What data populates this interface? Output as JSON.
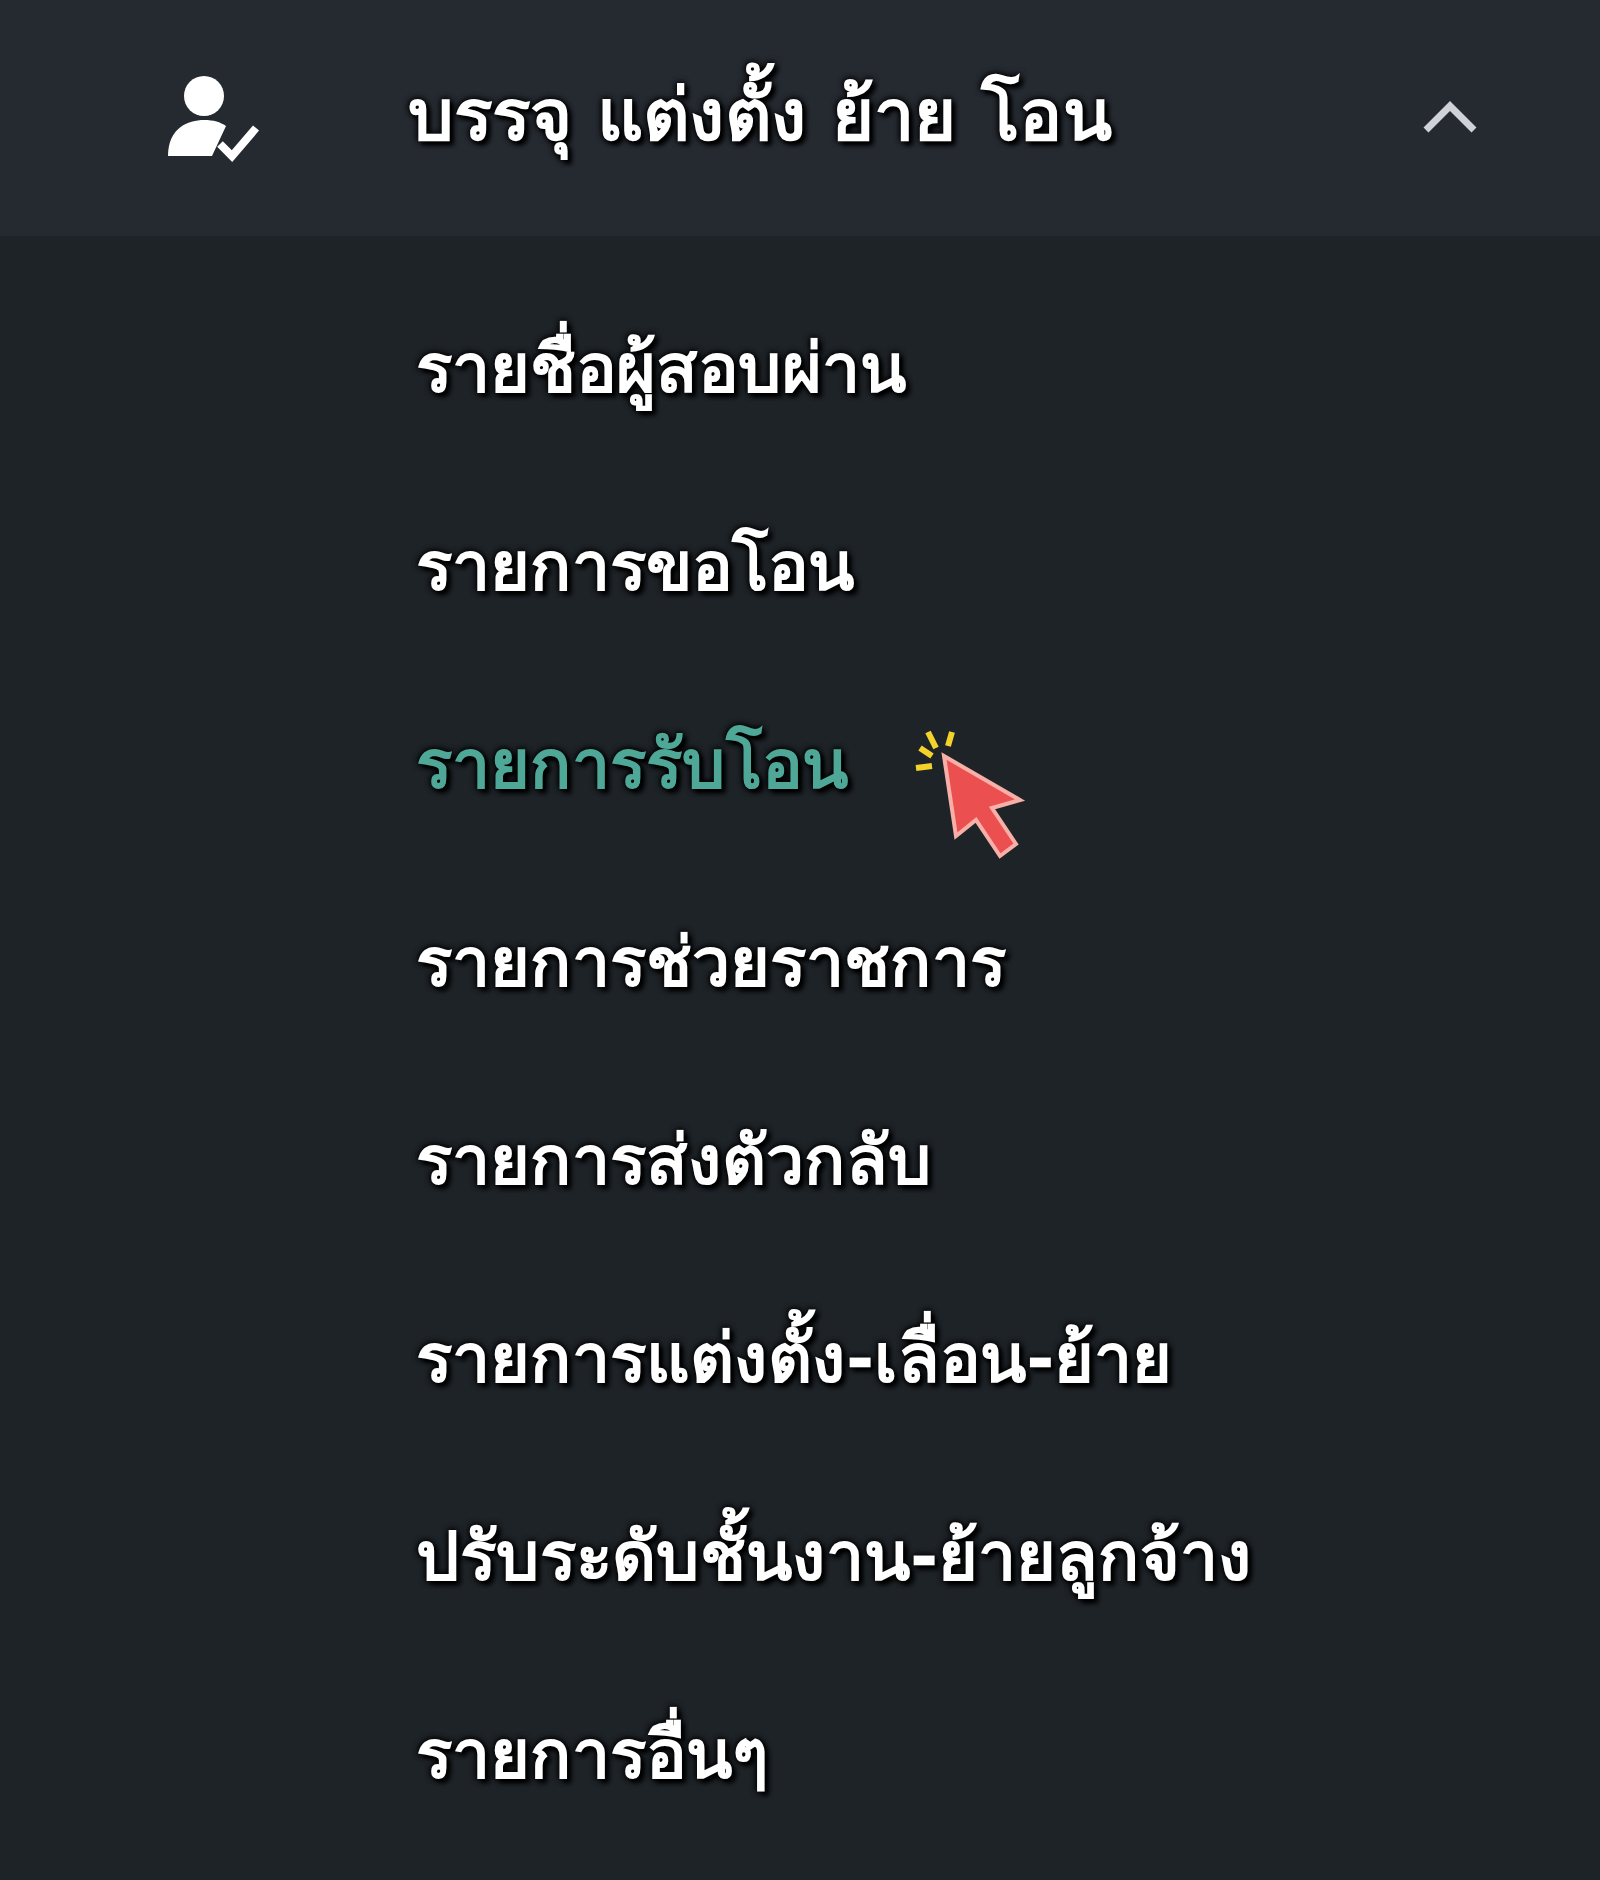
{
  "menu_group": {
    "label": "บรรจุ แต่งตั้ง ย้าย โอน",
    "expanded": true,
    "items": [
      {
        "label": "รายชื่อผู้สอบผ่าน",
        "selected": false
      },
      {
        "label": "รายการขอโอน",
        "selected": false
      },
      {
        "label": "รายการรับโอน",
        "selected": true
      },
      {
        "label": "รายการช่วยราชการ",
        "selected": false
      },
      {
        "label": "รายการส่งตัวกลับ",
        "selected": false
      },
      {
        "label": "รายการแต่งตั้ง-เลื่อน-ย้าย",
        "selected": false
      },
      {
        "label": "ปรับระดับชั้นงาน-ย้ายลูกจ้าง",
        "selected": false
      },
      {
        "label": "รายการอื่นๆ",
        "selected": false
      }
    ]
  }
}
